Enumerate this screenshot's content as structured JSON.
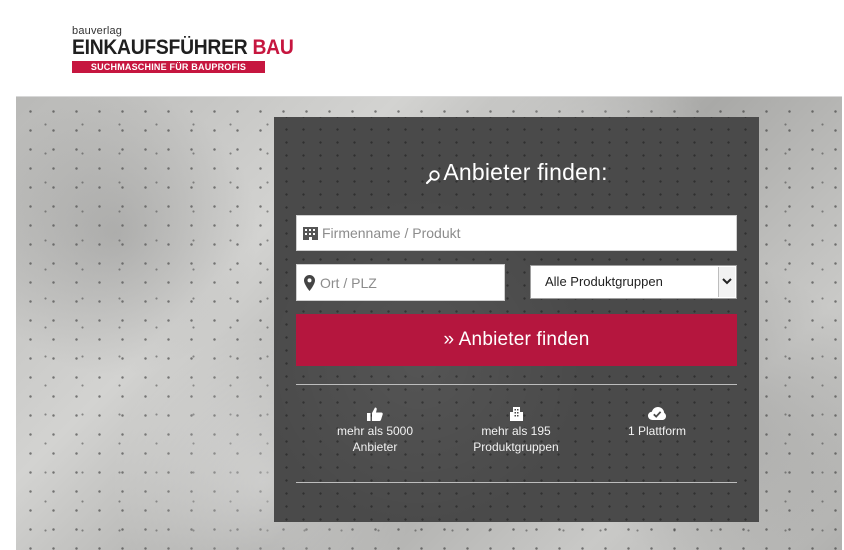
{
  "header": {
    "brand_small": "bauverlag",
    "brand_main": "EINKAUFSFÜHRER",
    "brand_accent": "BAU",
    "brand_tagline": "SUCHMASCHINE FÜR BAUPROFIS"
  },
  "search": {
    "title": "Anbieter finden:",
    "title_icon": "search-icon",
    "company_placeholder": "Firmenname / Produkt",
    "company_icon": "building-icon",
    "location_placeholder": "Ort / PLZ",
    "location_icon": "map-marker-icon",
    "product_group_selected": "Alle Produktgruppen",
    "submit_label": "» Anbieter finden"
  },
  "stats": [
    {
      "icon": "thumbs-up-icon",
      "line1": "mehr als 5000",
      "line2": "Anbieter"
    },
    {
      "icon": "buildings-icon",
      "line1": "mehr als 195",
      "line2": "Produktgruppen"
    },
    {
      "icon": "cloud-check-icon",
      "line1": "1 Plattform",
      "line2": ""
    }
  ],
  "colors": {
    "accent": "#c6163f",
    "button": "#b5163e",
    "panel": "#4a4a4a",
    "panel_text": "#ffffff"
  }
}
